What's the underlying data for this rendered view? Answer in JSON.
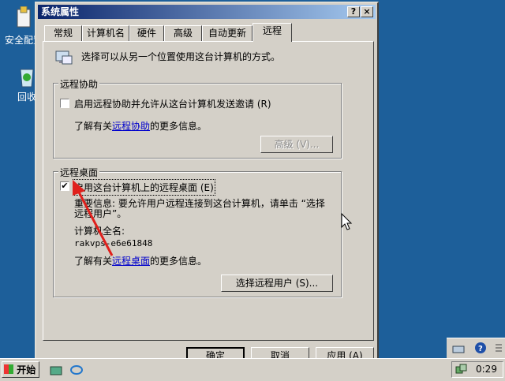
{
  "desktop": {
    "icons": [
      {
        "label": "安全配置",
        "icon": "security-config-icon"
      },
      {
        "label": "回收",
        "icon": "recycle-bin-icon"
      }
    ]
  },
  "dialog": {
    "title": "系统属性",
    "help_btn": "?",
    "close_btn": "×",
    "tabs": [
      "常规",
      "计算机名",
      "硬件",
      "高级",
      "自动更新",
      "远程"
    ],
    "active_tab": "远程",
    "intro_text": "选择可以从另一个位置使用这台计算机的方式。",
    "remote_assistance": {
      "group_title": "远程协助",
      "checkbox_label": "启用远程协助并允许从这台计算机发送邀请 (R)",
      "checked": false,
      "info_prefix": "了解有关",
      "info_link": "远程协助",
      "info_suffix": "的更多信息。",
      "advanced_button": "高级 (V)..."
    },
    "remote_desktop": {
      "group_title": "远程桌面",
      "checkbox_label": "启用这台计算机上的远程桌面 (E)",
      "checked": true,
      "note_line1": "重要信息: 要允许用户远程连接到这台计算机，请单击 “选择",
      "note_line2": "远程用户”。",
      "computer_name_label": "计算机全名:",
      "computer_name": "rakvps-e6e61848",
      "info_prefix": "了解有关",
      "info_link": "远程桌面",
      "info_suffix": "的更多信息。",
      "select_users_button": "选择远程用户 (S)..."
    },
    "buttons": {
      "ok": "确定",
      "cancel": "取消",
      "apply": "应用 (A)"
    }
  },
  "taskbar": {
    "start_label": "开始",
    "clock": "0:29"
  },
  "colors": {
    "titlebar": "#0a246a",
    "desktop": "#1d5f9a",
    "arrow": "#e0201c"
  }
}
